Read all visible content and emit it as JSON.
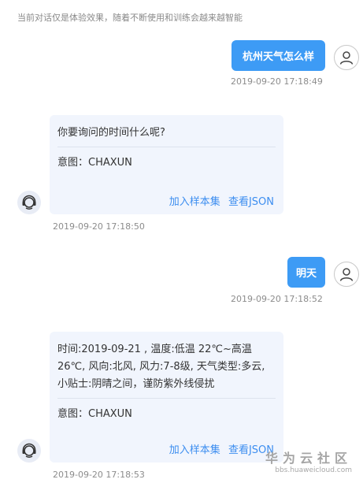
{
  "notice": "当前对话仅是体验效果，随着不断使用和训练会越来越智能",
  "messages": [
    {
      "user_text": "杭州天气怎么样",
      "timestamp": "2019-09-20 17:18:49"
    },
    {
      "bot_text": "你要询问的时间什么呢?",
      "intent": "意图：CHAXUN",
      "add_sample": "加入样本集",
      "view_json": "查看JSON",
      "timestamp": "2019-09-20 17:18:50"
    },
    {
      "user_text": "明天",
      "timestamp": "2019-09-20 17:18:52"
    },
    {
      "bot_text": "时间:2019-09-21 , 温度:低温 22℃~高温 26℃, 风向:北风, 风力:7-8级, 天气类型:多云, 小贴士:阴晴之间，谨防紫外线侵扰",
      "intent": "意图：CHAXUN",
      "add_sample": "加入样本集",
      "view_json": "查看JSON",
      "timestamp": "2019-09-20 17:18:53"
    }
  ],
  "watermark": {
    "title": "华为云社区",
    "url": "bbs.huaweicloud.com"
  },
  "icons": {
    "user_avatar": "user-outline-icon",
    "bot_avatar": "robot-headset-icon"
  },
  "colors": {
    "accent": "#3d9bf5",
    "bot_card_bg": "#f1f5fd",
    "link": "#3d8ef0"
  }
}
